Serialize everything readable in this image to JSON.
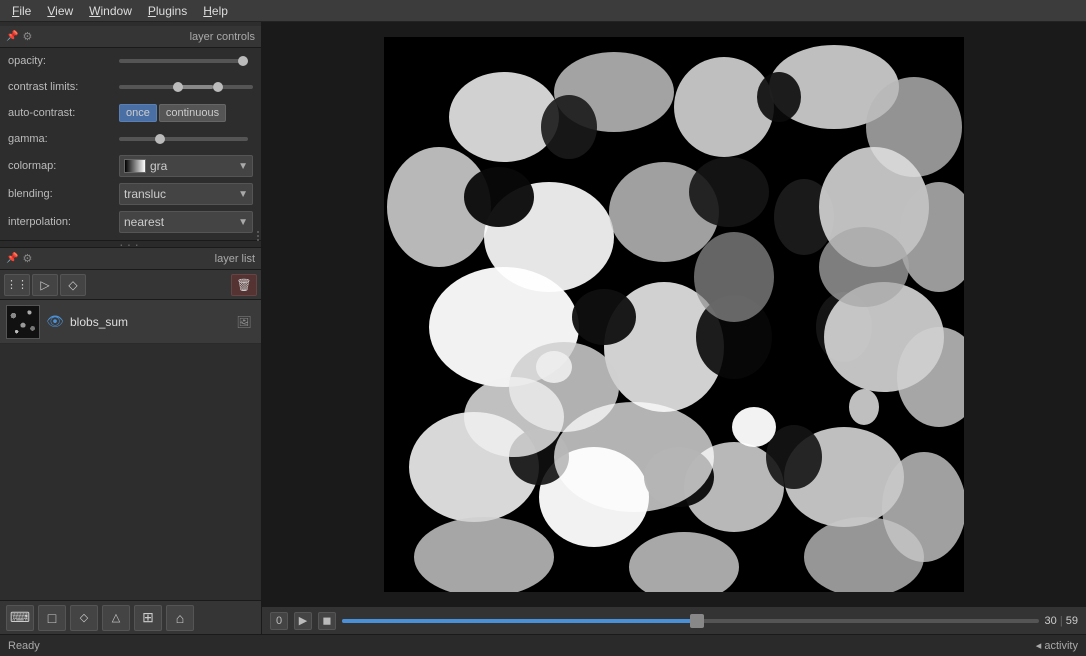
{
  "menubar": {
    "items": [
      {
        "id": "file",
        "label": "File",
        "underline": "F"
      },
      {
        "id": "view",
        "label": "View",
        "underline": "V"
      },
      {
        "id": "window",
        "label": "Window",
        "underline": "W"
      },
      {
        "id": "plugins",
        "label": "Plugins",
        "underline": "P"
      },
      {
        "id": "help",
        "label": "Help",
        "underline": "H"
      }
    ]
  },
  "layer_controls": {
    "title": "layer controls",
    "opacity": {
      "label": "opacity:",
      "value": 1.0,
      "value_display": "1.0",
      "percent": 100
    },
    "contrast_limits": {
      "label": "contrast limits:",
      "low": 40,
      "high": 70
    },
    "auto_contrast": {
      "label": "auto-contrast:",
      "once_label": "once",
      "continuous_label": "continuous"
    },
    "gamma": {
      "label": "gamma:",
      "value": 1.0,
      "value_display": "1.0",
      "percent": 30
    },
    "colormap": {
      "label": "colormap:",
      "value": "gray",
      "display": "gra"
    },
    "blending": {
      "label": "blending:",
      "value": "translucent",
      "display": "transluc"
    },
    "interpolation": {
      "label": "interpolation:",
      "value": "nearest",
      "display": "nearest"
    }
  },
  "layer_list": {
    "title": "layer list",
    "layers": [
      {
        "id": "blobs_sum",
        "name": "blobs_sum",
        "visible": true,
        "type": "image"
      }
    ]
  },
  "timeline": {
    "current_frame": 30,
    "total_frames": 59,
    "display": "30 | 59",
    "progress_percent": 51
  },
  "statusbar": {
    "ready": "Ready",
    "activity": "◂ activity"
  },
  "toolbar": {
    "console_label": "⌨",
    "square_label": "□",
    "path_label": "◇",
    "path2_label": "△",
    "grid_label": "⊞",
    "home_label": "⌂"
  },
  "layer_list_toolbar": {
    "points_icon": "⋮⋮",
    "shapes_icon": "▷",
    "labels_icon": "◇",
    "delete_icon": "🗑"
  }
}
